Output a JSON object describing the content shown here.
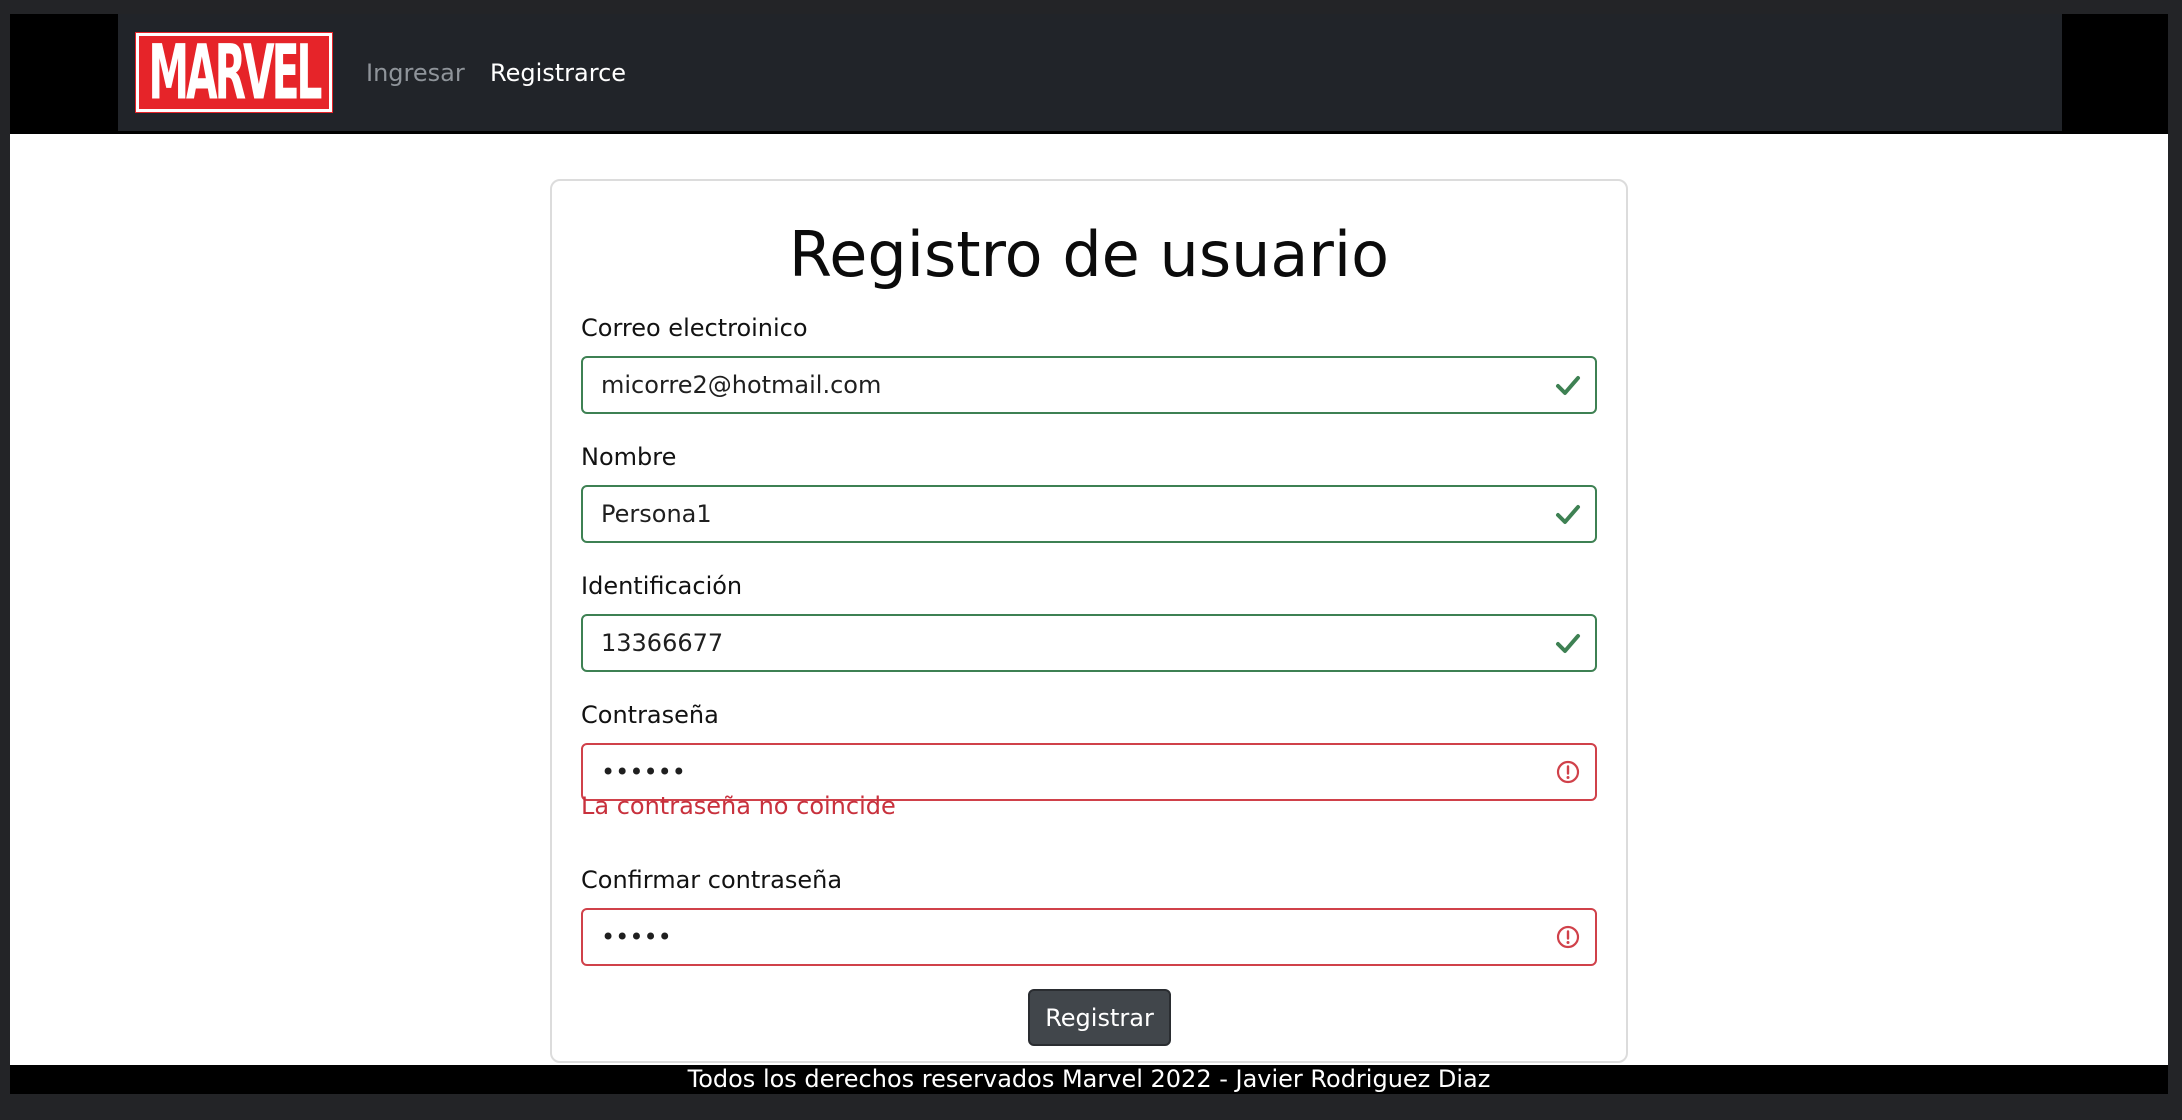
{
  "navbar": {
    "logo_text": "MARVEL",
    "links": [
      {
        "label": "Ingresar",
        "active": false
      },
      {
        "label": "Registrarce",
        "active": true
      }
    ]
  },
  "form": {
    "title": "Registro de usuario",
    "fields": [
      {
        "label": "Correo electroinico",
        "value": "micorre2@hotmail.com",
        "state": "valid",
        "icon": "check-icon"
      },
      {
        "label": "Nombre",
        "value": "Persona1",
        "state": "valid",
        "icon": "check-icon"
      },
      {
        "label": "Identificación",
        "value": "13366677",
        "state": "valid",
        "icon": "check-icon"
      },
      {
        "label": "Contraseña",
        "value": "123456",
        "state": "invalid",
        "icon": "alert-circle-icon",
        "error": "La contraseña no coincide"
      },
      {
        "label": "Confirmar contraseña",
        "value": "12345",
        "state": "invalid",
        "icon": "alert-circle-icon"
      }
    ],
    "submit_label": "Registrar"
  },
  "footer": {
    "text": "Todos los derechos reservados Marvel 2022 - Javier Rodriguez Diaz"
  },
  "colors": {
    "brand_red": "#e62429",
    "navbar_bg": "#212429",
    "valid": "#3e8153",
    "invalid": "#d0414a",
    "button_bg": "#41464b"
  }
}
